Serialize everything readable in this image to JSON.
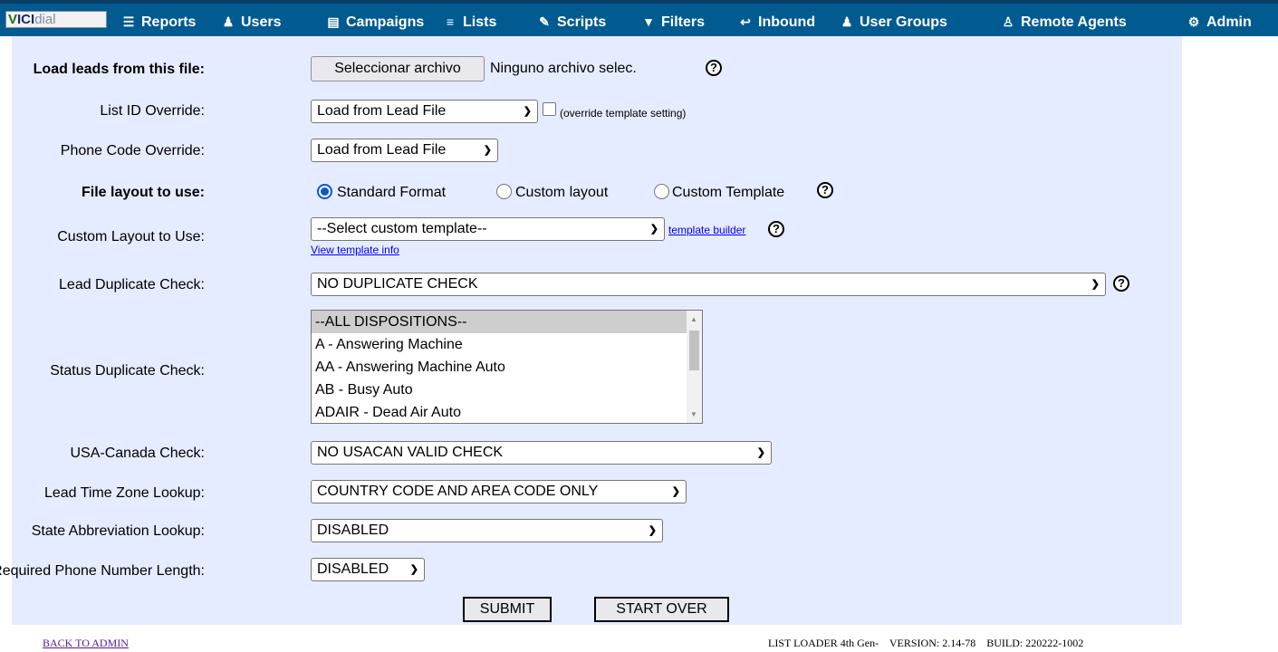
{
  "nav": {
    "logo_a": "V",
    "logo_b": "ICI",
    "logo_c": "dial",
    "items": [
      {
        "label": "Reports",
        "icon": "reports-icon"
      },
      {
        "label": "Users",
        "icon": "users-icon"
      },
      {
        "label": "Campaigns",
        "icon": "campaigns-icon"
      },
      {
        "label": "Lists",
        "icon": "lists-icon"
      },
      {
        "label": "Scripts",
        "icon": "scripts-icon"
      },
      {
        "label": "Filters",
        "icon": "filter-icon"
      },
      {
        "label": "Inbound",
        "icon": "inbound-icon"
      },
      {
        "label": "User Groups",
        "icon": "user-groups-icon"
      },
      {
        "label": "Remote Agents",
        "icon": "remote-agents-icon"
      },
      {
        "label": "Admin",
        "icon": "gear-icon"
      }
    ]
  },
  "form": {
    "load_file": {
      "label": "Load leads from this file:",
      "button": "Seleccionar archivo",
      "status": "Ninguno archivo selec."
    },
    "list_id": {
      "label": "List ID Override:",
      "value": "Load from Lead File",
      "checkbox_label": "(override template setting)"
    },
    "phone_code": {
      "label": "Phone Code Override:",
      "value": "Load from Lead File"
    },
    "file_layout": {
      "label": "File layout to use:",
      "options": [
        "Standard Format",
        "Custom layout",
        "Custom Template"
      ],
      "selected": "Standard Format"
    },
    "custom_layout": {
      "label": "Custom Layout to Use:",
      "value": "--Select custom template--",
      "builder_link": "template builder",
      "info_link": "View template info"
    },
    "lead_dup": {
      "label": "Lead Duplicate Check:",
      "value": "NO DUPLICATE CHECK"
    },
    "status_dup": {
      "label": "Status Duplicate Check:",
      "options": [
        "--ALL DISPOSITIONS--",
        "A - Answering Machine",
        "AA - Answering Machine Auto",
        "AB - Busy Auto",
        "ADAIR - Dead Air Auto"
      ],
      "selected": "--ALL DISPOSITIONS--"
    },
    "usacan": {
      "label": "USA-Canada Check:",
      "value": "NO USACAN VALID CHECK"
    },
    "tz_lookup": {
      "label": "Lead Time Zone Lookup:",
      "value": "COUNTRY CODE AND AREA CODE ONLY"
    },
    "state_abbr": {
      "label": "State Abbreviation Lookup:",
      "value": "DISABLED"
    },
    "phone_len": {
      "label": "Required Phone Number Length:",
      "value": "DISABLED"
    },
    "submit_label": "SUBMIT",
    "startover_label": "START OVER"
  },
  "footer": {
    "back_link": "BACK TO ADMIN",
    "version_text": "LIST LOADER 4th Gen-    VERSION: 2.14-78    BUILD: 220222-1002"
  },
  "colors": {
    "nav_bg": "#015b91",
    "panel_bg": "#e5ecff"
  }
}
